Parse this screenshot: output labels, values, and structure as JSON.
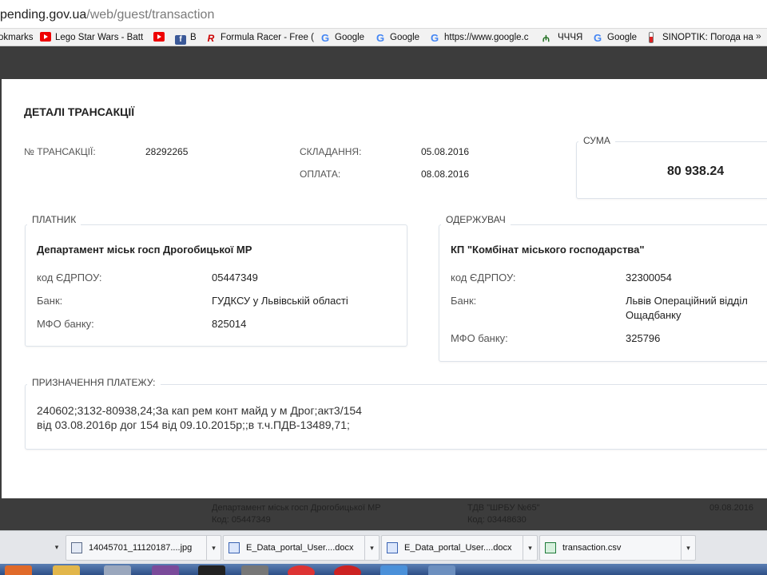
{
  "browser": {
    "url_host": "pending.gov.ua",
    "url_path": "/web/guest/transaction",
    "bookmarks": [
      {
        "label": "okmarks",
        "icon": "none"
      },
      {
        "label": "Lego Star Wars - Batt",
        "icon": "youtube-icon"
      },
      {
        "label": "",
        "icon": "youtube-icon"
      },
      {
        "label": "B",
        "icon": "facebook-icon"
      },
      {
        "label": "Formula Racer - Free (",
        "icon": "formula-icon"
      },
      {
        "label": "Google",
        "icon": "google-icon"
      },
      {
        "label": "Google",
        "icon": "google-icon"
      },
      {
        "label": "https://www.google.c",
        "icon": "google-icon"
      },
      {
        "label": "ЧЧЧЯ",
        "icon": "site-icon"
      },
      {
        "label": "Google",
        "icon": "google-icon"
      },
      {
        "label": "SINOPTIK: Погода на",
        "icon": "thermometer-icon"
      }
    ],
    "bookmarks_more": "»"
  },
  "modal": {
    "title": "ДЕТАЛІ ТРАНСАКЦІЇ",
    "transaction_label": "№ ТРАНСАКЦІЇ:",
    "transaction_value": "28292265",
    "compose_label": "СКЛАДАННЯ:",
    "compose_value": "05.08.2016",
    "payment_label": "ОПЛАТА:",
    "payment_value": "08.08.2016",
    "sum_legend": "СУМА",
    "sum_value": "80 938.24",
    "payer": {
      "legend": "ПЛАТНИК",
      "name": "Департамент міськ госп Дрогобицької МР",
      "edrpou_label": "код ЄДРПОУ:",
      "edrpou_value": "05447349",
      "bank_label": "Банк:",
      "bank_value": "ГУДКСУ у Львівській області",
      "mfo_label": "МФО банку:",
      "mfo_value": "825014"
    },
    "receiver": {
      "legend": "ОДЕРЖУВАЧ",
      "name": "КП \"Комбінат міського господарства\"",
      "edrpou_label": "код ЄДРПОУ:",
      "edrpou_value": "32300054",
      "bank_label": "Банк:",
      "bank_value_line1": "Львів Операційний відділ",
      "bank_value_line2": "Ощадбанку",
      "mfo_label": "МФО банку:",
      "mfo_value": "325796"
    },
    "purpose": {
      "legend": "ПРИЗНАЧЕННЯ ПЛАТЕЖУ:",
      "line1": "240602;3132-80938,24;За кап рем конт майд у м Дрог;акт3/154",
      "line2": "від 03.08.2016р дог 154 від 09.10.2015р;;в т.ч.ПДВ-13489,71;"
    }
  },
  "behind_table": {
    "payer_name": "Департамент міськ госп Дрогобицької МР",
    "payer_code": "Код: 05447349",
    "receiver_name": "ТДВ \"ШРБУ №65\"",
    "receiver_code": "Код: 03448630",
    "date": "09.08.2016"
  },
  "downloads": [
    {
      "name": "14045701_11120187....jpg",
      "type": "image"
    },
    {
      "name": "E_Data_portal_User....docx",
      "type": "word"
    },
    {
      "name": "E_Data_portal_User....docx",
      "type": "word"
    },
    {
      "name": "transaction.csv",
      "type": "excel"
    }
  ],
  "dropdown_arrow": "▾"
}
